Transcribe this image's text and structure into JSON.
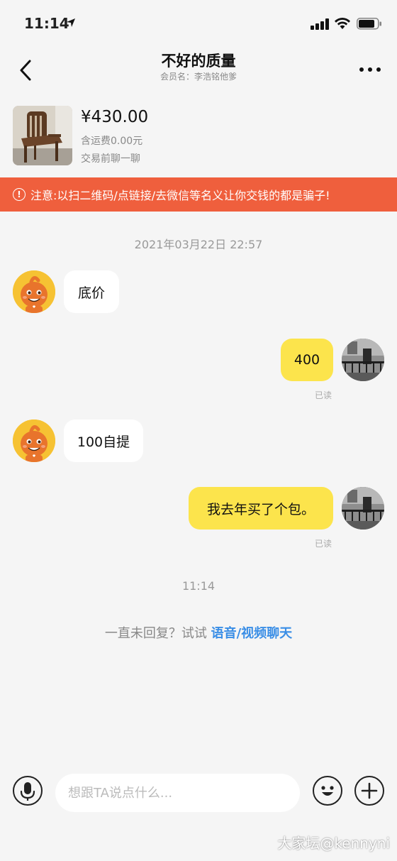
{
  "status_bar": {
    "time": "11:14"
  },
  "nav": {
    "title": "不好的质量",
    "subtitle": "会员名：李浩铭他爹"
  },
  "product": {
    "price": "¥430.00",
    "shipping": "含运费0.00元",
    "note": "交易前聊一聊"
  },
  "warning": {
    "text": "注意:以扫二维码/点链接/去微信等名义让你交钱的都是骗子!"
  },
  "messages": [
    {
      "side": "left",
      "text": "底价"
    },
    {
      "side": "right",
      "text": "400",
      "status": "已读"
    },
    {
      "side": "left",
      "text": "100自提"
    },
    {
      "side": "right",
      "text": "我去年买了个包。",
      "status": "已读"
    }
  ],
  "timestamps": {
    "first": "2021年03月22日  22:57",
    "second": "11:14"
  },
  "hint": {
    "prefix": "一直未回复？试试 ",
    "link": "语音/视频聊天"
  },
  "input": {
    "placeholder": "想跟TA说点什么..."
  },
  "watermark": "大家坛@kennyni",
  "colors": {
    "warning_bg": "#ef5f3d",
    "my_bubble": "#fce44c",
    "other_bubble": "#ffffff",
    "link": "#3a8ee6",
    "background": "#f5f5f5"
  }
}
